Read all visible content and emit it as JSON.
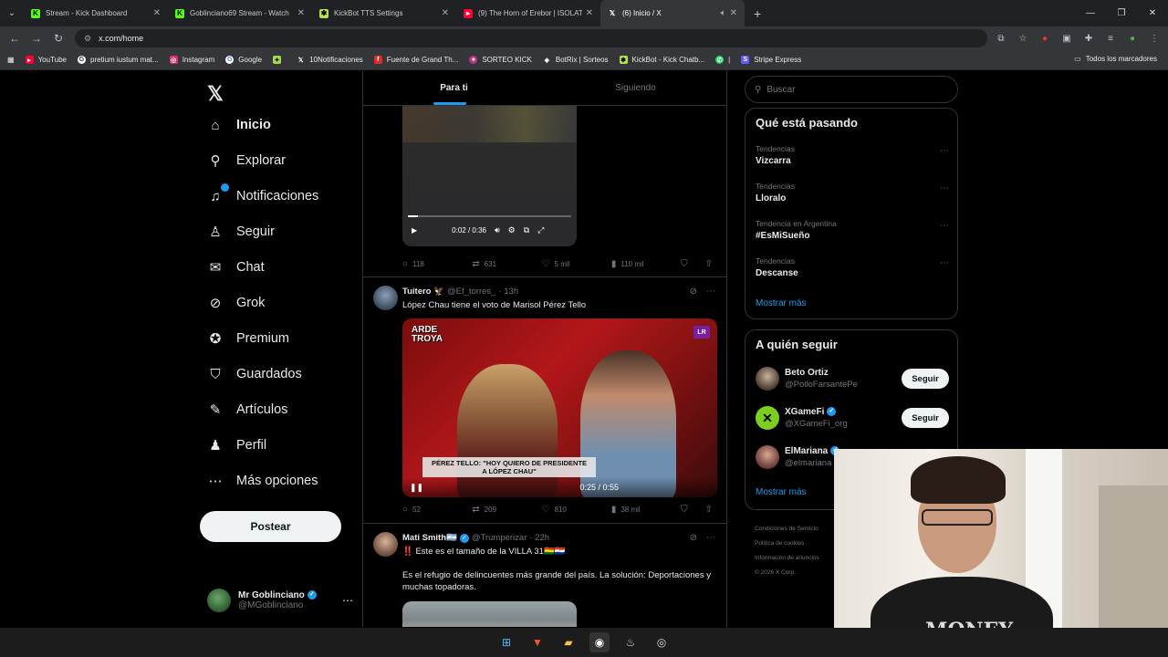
{
  "browser": {
    "tabs": [
      {
        "title": "Stream - Kick Dashboard",
        "icon": "kick-icon",
        "color": "#53fc18"
      },
      {
        "title": "Goblinciano69 Stream - Watch",
        "icon": "kick-icon",
        "color": "#53fc18"
      },
      {
        "title": "KickBot TTS Settings",
        "icon": "kickbot-icon",
        "color": "#b4e34b"
      },
      {
        "title": "(9) The Horn of Erebor | ISOLAT",
        "icon": "youtube-icon",
        "color": "#ff0033"
      },
      {
        "title": "(6) Inicio / X",
        "icon": "x-icon",
        "color": "#ffffff"
      }
    ],
    "url": "x.com/home",
    "bookmarks": [
      {
        "label": "YouTube",
        "color": "#ff0033"
      },
      {
        "label": "pretium iustum mat...",
        "color": "#ffffff"
      },
      {
        "label": "Instagram",
        "color": "#e1306c"
      },
      {
        "label": "Google",
        "color": "#ffffff"
      },
      {
        "label": "",
        "color": "#a6d94a"
      },
      {
        "label": "10Notificaciones",
        "color": "#ffffff"
      },
      {
        "label": "Fuente de Grand Th...",
        "color": "#d93025"
      },
      {
        "label": "SORTEO KICK",
        "color": "#c13584"
      },
      {
        "label": "BotRix | Sorteos",
        "color": "#eeeeee"
      },
      {
        "label": "KickBot - Kick Chatb...",
        "color": "#b4e34b"
      },
      {
        "label": "|",
        "color": "#25d366"
      },
      {
        "label": "Stripe Express",
        "color": "#635bff"
      }
    ],
    "all_bookmarks": "Todos los marcadores"
  },
  "nav": {
    "items": [
      {
        "label": "Inicio",
        "icon": "home-icon"
      },
      {
        "label": "Explorar",
        "icon": "search-icon"
      },
      {
        "label": "Notificaciones",
        "icon": "bell-icon"
      },
      {
        "label": "Seguir",
        "icon": "add-person-icon"
      },
      {
        "label": "Chat",
        "icon": "mail-icon"
      },
      {
        "label": "Grok",
        "icon": "grok-icon"
      },
      {
        "label": "Premium",
        "icon": "verified-icon"
      },
      {
        "label": "Guardados",
        "icon": "bookmark-icon"
      },
      {
        "label": "Artículos",
        "icon": "article-icon"
      },
      {
        "label": "Perfil",
        "icon": "person-icon"
      },
      {
        "label": "Más opciones",
        "icon": "more-icon"
      }
    ],
    "post_button": "Postear",
    "account": {
      "name": "Mr Goblinciano",
      "handle": "@MGoblinciano"
    }
  },
  "feed": {
    "tabs": [
      "Para ti",
      "Siguiendo"
    ],
    "post1": {
      "video_time": "0:02 / 0:36",
      "video_progress": 0.06,
      "replies": "118",
      "reposts": "631",
      "likes": "5 mil",
      "views": "110 mil"
    },
    "post2": {
      "name": "Tuitero 🦅",
      "handle": "@Ef_torres_",
      "time": "· 13h",
      "text": "López Chau tiene el voto de Marisol Pérez Tello",
      "video_time": "0:25 / 0:55",
      "overlay_brand": "ARDE\nTROYA",
      "overlay_logo": "LR",
      "lower_third": "PÉREZ TELLO: \"HOY QUIERO DE PRESIDENTE\nA LÓPEZ CHAU\"",
      "replies": "52",
      "reposts": "209",
      "likes": "810",
      "views": "38 mil"
    },
    "post3": {
      "name": "Mati Smith🇦🇷",
      "handle": "@Trumperizar",
      "time": "· 22h",
      "text1": "‼️ Este es el tamaño de la VILLA 31🇧🇴🇵🇾",
      "text2": "Es el refugio de delincuentes más grande del país. La solución: Deportaciones y muchas topadoras."
    }
  },
  "sidebar": {
    "search_placeholder": "Buscar",
    "trends_title": "Qué está pasando",
    "trends": [
      {
        "context": "Tendencias",
        "name": "Vizcarra"
      },
      {
        "context": "Tendencias",
        "name": "Lloralo"
      },
      {
        "context": "Tendencia en Argentina",
        "name": "#EsMiSueño"
      },
      {
        "context": "Tendencias",
        "name": "Descanse"
      }
    ],
    "show_more": "Mostrar más",
    "who_title": "A quién seguir",
    "who": [
      {
        "name": "Beto Ortiz",
        "handle": "@PolloFarsantePe",
        "verified": false
      },
      {
        "name": "XGameFi",
        "handle": "@XGameFi_org",
        "verified": true
      },
      {
        "name": "ElMariana",
        "handle": "@elmariana",
        "verified": true
      }
    ],
    "follow": "Seguir",
    "show_more2": "Mostrar más",
    "footer": [
      "Condiciones de Servicio",
      "Política de cookies",
      "Información de anuncios",
      "© 2026 X Corp."
    ]
  },
  "webcam": {
    "shirt_text": "MONEY"
  }
}
